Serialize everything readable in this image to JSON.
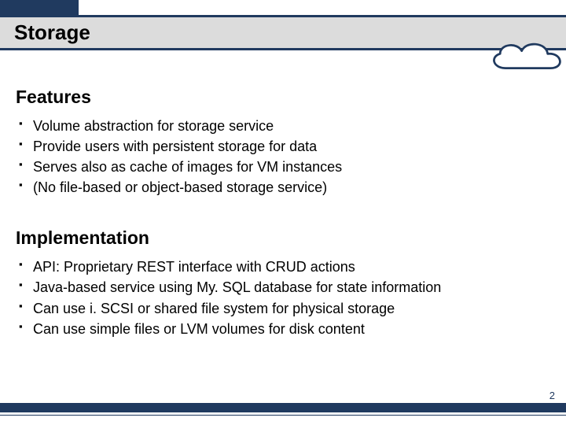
{
  "title": "Storage",
  "sections": [
    {
      "heading": "Features",
      "items": [
        "Volume abstraction for storage service",
        "Provide users with persistent storage for data",
        "Serves also as cache of images for VM instances",
        "(No file-based or object-based storage service)"
      ]
    },
    {
      "heading": "Implementation",
      "items": [
        "API: Proprietary REST interface with CRUD actions",
        "Java-based service using My. SQL database for state information",
        "Can use i. SCSI or shared file system for physical storage",
        "Can use simple files or LVM volumes for disk content"
      ]
    }
  ],
  "page_number": "2"
}
